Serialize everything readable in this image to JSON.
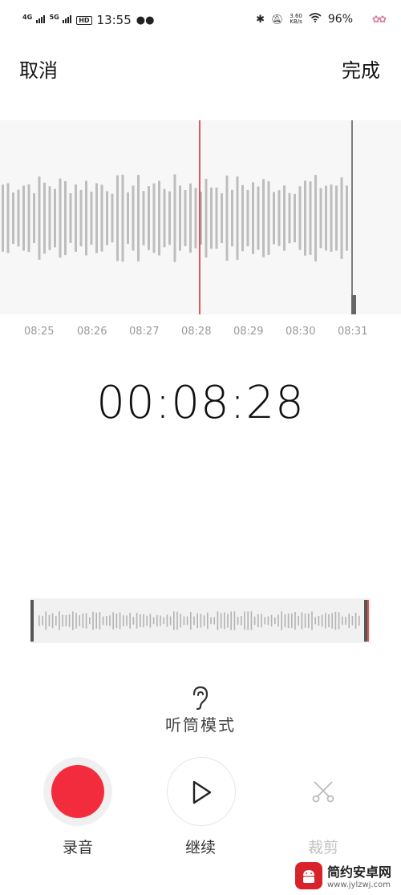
{
  "status_bar": {
    "net1": "4G",
    "net2": "5G",
    "hd": "HD",
    "time": "13:55",
    "speed_top": "3.60",
    "speed_bottom": "KB/s",
    "battery": "96%"
  },
  "header": {
    "cancel_label": "取消",
    "done_label": "完成"
  },
  "waveform": {
    "playhead_color": "#e02020",
    "time_ticks": [
      "08:25",
      "08:26",
      "08:27",
      "08:28",
      "08:29",
      "08:30",
      "08:31"
    ]
  },
  "timer": {
    "value": "00:08:28"
  },
  "earpiece": {
    "label": "听筒模式",
    "icon": "ear-icon"
  },
  "controls": {
    "record_label": "录音",
    "continue_label": "继续",
    "trim_label": "裁剪",
    "record_color": "#f22c3d"
  },
  "watermark": {
    "name": "简约安卓网",
    "url": "www.jylzwj.com"
  }
}
